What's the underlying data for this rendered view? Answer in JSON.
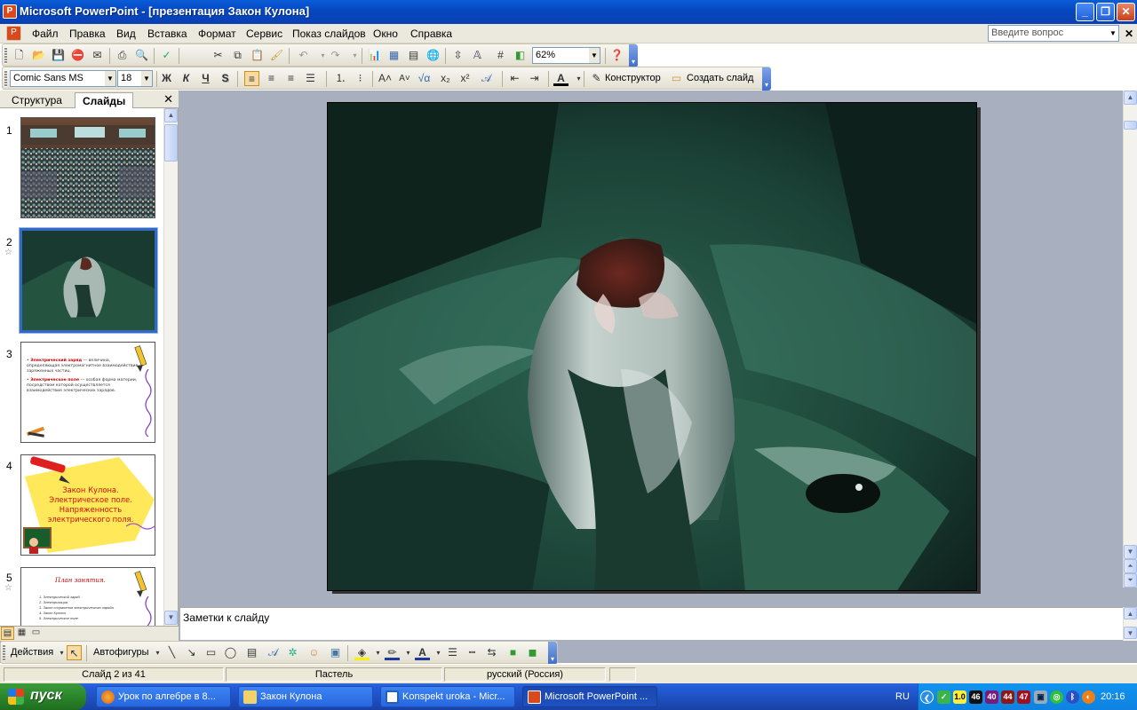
{
  "window": {
    "title": "Microsoft PowerPoint - [презентация Закон Кулона]"
  },
  "menu": {
    "items": [
      "Файл",
      "Правка",
      "Вид",
      "Вставка",
      "Формат",
      "Сервис",
      "Показ слайдов",
      "Окно",
      "Справка"
    ],
    "help_placeholder": "Введите вопрос"
  },
  "toolbar_standard": {
    "zoom": "62%"
  },
  "toolbar_formatting": {
    "font": "Comic Sans MS",
    "size": "18",
    "designer_label": "Конструктор",
    "new_slide_label": "Создать слайд"
  },
  "left_panel": {
    "tab_outline": "Структура",
    "tab_slides": "Слайды",
    "slide_numbers": [
      "1",
      "2",
      "3",
      "4",
      "5"
    ]
  },
  "thumb3": {
    "bullet1_title": "Электрический заряд",
    "bullet1_rest": " — величина, определяющая электромагнитное взаимодействие заряженных частиц.",
    "bullet2_title": "Электрическое поле",
    "bullet2_rest": " — особая форма материи, посредством которой осуществляется взаимодействие электрических зарядов."
  },
  "thumb4": {
    "text": "Закон Кулона. Электрическое поле. Напряженность электрического поля."
  },
  "thumb5": {
    "title": "План занятия.",
    "items": [
      "1. Электрический заряд.",
      "2. Электризация.",
      "3. Закон сохранения электрического заряда.",
      "4. Закон Кулона.",
      "5. Электрическое поле."
    ]
  },
  "notes": {
    "placeholder": "Заметки к слайду"
  },
  "drawing_toolbar": {
    "actions_label": "Действия",
    "autoshapes_label": "Автофигуры"
  },
  "status": {
    "slide": "Слайд 2 из 41",
    "design": "Пастель",
    "language": "русский (Россия)"
  },
  "taskbar": {
    "start_label": "пуск",
    "tasks": [
      "Урок по алгебре в 8...",
      "Закон Кулона",
      "Konspekt uroka - Micr...",
      "Microsoft PowerPoint ..."
    ],
    "lang": "RU",
    "tray_numbers": [
      "1.0",
      "46",
      "40",
      "44",
      "47"
    ],
    "clock": "20:16"
  }
}
